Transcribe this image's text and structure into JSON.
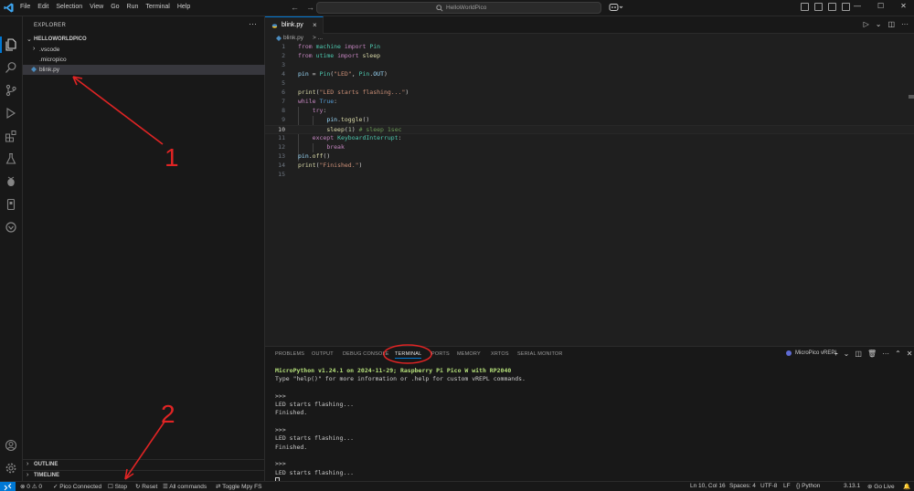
{
  "title_bar": {
    "menu": [
      "File",
      "Edit",
      "Selection",
      "View",
      "Go",
      "Run",
      "Terminal",
      "Help"
    ],
    "command_center": "HelloWorldPico"
  },
  "sidebar": {
    "title": "EXPLORER",
    "folder": "HELLOWORLDPICO",
    "items": [
      {
        "label": ".vscode",
        "type": "folder"
      },
      {
        "label": ".micropico",
        "type": "file"
      },
      {
        "label": "blink.py",
        "type": "python",
        "selected": true
      }
    ],
    "outline": "OUTLINE",
    "timeline": "TIMELINE"
  },
  "editor": {
    "tab_label": "blink.py",
    "breadcrumb_file": "blink.py",
    "breadcrumb_more": "> ...",
    "current_line": 10,
    "lines": [
      {
        "n": "1",
        "text": "from machine import Pin"
      },
      {
        "n": "2",
        "text": "from utime import sleep"
      },
      {
        "n": "3",
        "text": ""
      },
      {
        "n": "4",
        "text": "pin = Pin(\"LED\", Pin.OUT)"
      },
      {
        "n": "5",
        "text": ""
      },
      {
        "n": "6",
        "text": "print(\"LED starts flashing...\")"
      },
      {
        "n": "7",
        "text": "while True:"
      },
      {
        "n": "8",
        "text": "    try:"
      },
      {
        "n": "9",
        "text": "        pin.toggle()"
      },
      {
        "n": "10",
        "text": "        sleep(1) # sleep 1sec"
      },
      {
        "n": "11",
        "text": "    except KeyboardInterrupt:"
      },
      {
        "n": "12",
        "text": "        break"
      },
      {
        "n": "13",
        "text": "pin.off()"
      },
      {
        "n": "14",
        "text": "print(\"Finished.\")"
      },
      {
        "n": "15",
        "text": ""
      }
    ]
  },
  "panel": {
    "tabs": [
      "PROBLEMS",
      "OUTPUT",
      "DEBUG CONSOLE",
      "TERMINAL",
      "PORTS",
      "MEMORY",
      "XRTOS",
      "SERIAL MONITOR"
    ],
    "active_tab": "TERMINAL",
    "terminal_name": "MicroPico vREPL",
    "terminal_lines": [
      "MicroPython v1.24.1 on 2024-11-29; Raspberry Pi Pico W with RP2040",
      "Type \"help()\" for more information or .help for custom vREPL commands.",
      "",
      ">>>",
      "LED starts flashing...",
      "Finished.",
      "",
      ">>>",
      "LED starts flashing...",
      "Finished.",
      "",
      ">>>",
      "LED starts flashing..."
    ]
  },
  "status_bar": {
    "problems_errors": "0",
    "problems_warnings": "0",
    "pico_connected": "Pico Connected",
    "stop": "Stop",
    "reset": "Reset",
    "all_commands": "All commands",
    "toggle_fs": "Toggle Mpy FS",
    "position": "Ln 10, Col 16",
    "spaces": "Spaces: 4",
    "encoding": "UTF-8",
    "eol": "LF",
    "language": "Python",
    "python_version": "3.13.1",
    "go_live": "Go Live"
  },
  "annotations": {
    "label_1": "1",
    "label_2": "2",
    "color": "#e02424"
  },
  "colors": {
    "accent": "#0078d4",
    "editor_bg": "#1f1f1f",
    "sidebar_bg": "#181818"
  }
}
